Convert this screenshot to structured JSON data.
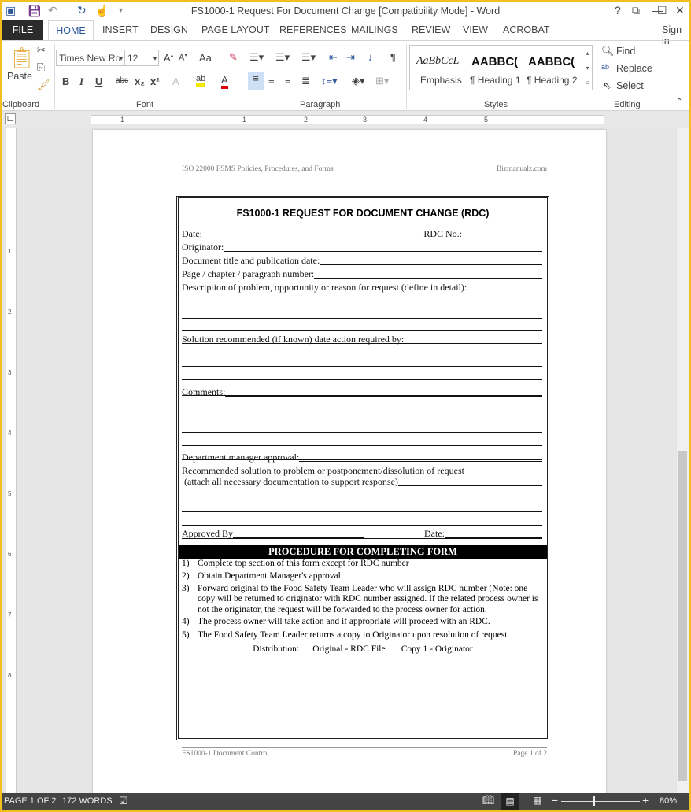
{
  "window": {
    "title": "FS1000-1 Request For Document Change [Compatibility Mode] - Word",
    "controls": [
      "?",
      "⧉",
      "—",
      "☐",
      "✕"
    ]
  },
  "quick_access": {
    "icons": [
      "word-icon",
      "save-icon",
      "undo-icon",
      "redo-icon",
      "touch-mode-icon",
      "customize-icon"
    ]
  },
  "tabs": [
    {
      "label": "FILE"
    },
    {
      "label": "HOME",
      "active": true
    },
    {
      "label": "INSERT"
    },
    {
      "label": "DESIGN"
    },
    {
      "label": "PAGE LAYOUT"
    },
    {
      "label": "REFERENCES"
    },
    {
      "label": "MAILINGS"
    },
    {
      "label": "REVIEW"
    },
    {
      "label": "VIEW"
    },
    {
      "label": "ACROBAT"
    }
  ],
  "sign_in": "Sign in",
  "ribbon": {
    "clipboard": {
      "label": "Clipboard",
      "paste": "Paste"
    },
    "font": {
      "label": "Font",
      "font_name": "Times New Ro",
      "font_size": "12",
      "change_case": "Aa",
      "bold": "B",
      "italic": "I",
      "underline": "U",
      "strikethrough": "abc",
      "subscript": "x₂",
      "superscript": "x²"
    },
    "paragraph": {
      "label": "Paragraph",
      "pilcrow": "¶"
    },
    "styles": {
      "label": "Styles",
      "items": [
        {
          "preview": "AaBbCcL",
          "name": "Emphasis"
        },
        {
          "preview": "AABBC(",
          "name": "¶ Heading 1"
        },
        {
          "preview": "AABBC(",
          "name": "¶ Heading 2"
        }
      ]
    },
    "editing": {
      "label": "Editing",
      "find": "Find",
      "replace": "Replace",
      "select": "Select"
    }
  },
  "ruler": {
    "numbers": [
      "1",
      "1",
      "2",
      "3",
      "4",
      "5"
    ],
    "vnumbers": [
      "1",
      "2",
      "3",
      "4",
      "5",
      "6",
      "7",
      "8"
    ]
  },
  "document": {
    "header_left": "ISO 22000 FSMS Policies, Procedures, and Forms",
    "header_right": "Bizmanualz.com",
    "form_title": "FS1000-1   REQUEST FOR DOCUMENT CHANGE (RDC)",
    "fields": {
      "date": "Date:",
      "rdc_no": "RDC No.:",
      "originator": "Originator:",
      "doc_title": "Document title and publication date:",
      "page_ref": "Page / chapter / paragraph number:",
      "description": "Description of problem, opportunity or reason for request (define in detail):",
      "solution": "Solution recommended (if known) date action required by:",
      "comments": "Comments:",
      "dept_approval": "Department manager approval:",
      "recommended": "Recommended solution to problem or postponement/dissolution of request",
      "attach": " (attach all necessary documentation to support response)",
      "approved_by": "Approved By",
      "approved_date": "Date:"
    },
    "procedure_title": "PROCEDURE FOR COMPLETING FORM",
    "steps": [
      {
        "n": "1)",
        "text": "Complete top section of this form except for RDC number"
      },
      {
        "n": "2)",
        "text": "Obtain Department Manager's approval"
      },
      {
        "n": "3)",
        "text": "Forward original to the Food Safety Team Leader who will assign RDC number (Note: one copy will be returned to originator with RDC number assigned. If the related process owner is not the originator, the request will be forwarded to the process owner for action."
      },
      {
        "n": "4)",
        "text": "The process owner will take action and if appropriate will proceed with an RDC."
      },
      {
        "n": "5)",
        "text": "The Food Safety Team Leader returns a copy to Originator upon resolution of request."
      }
    ],
    "distribution": "Distribution:      Original - RDC File       Copy 1 - Originator",
    "footer_left": "FS1000-1 Document Control",
    "footer_right": "Page 1 of 2"
  },
  "status": {
    "page": "PAGE 1 OF 2",
    "words": "172 WORDS",
    "zoom": "80%"
  },
  "colors": {
    "frame": "#f0c020",
    "accent": "#2b579a",
    "status_bar": "#444444"
  }
}
